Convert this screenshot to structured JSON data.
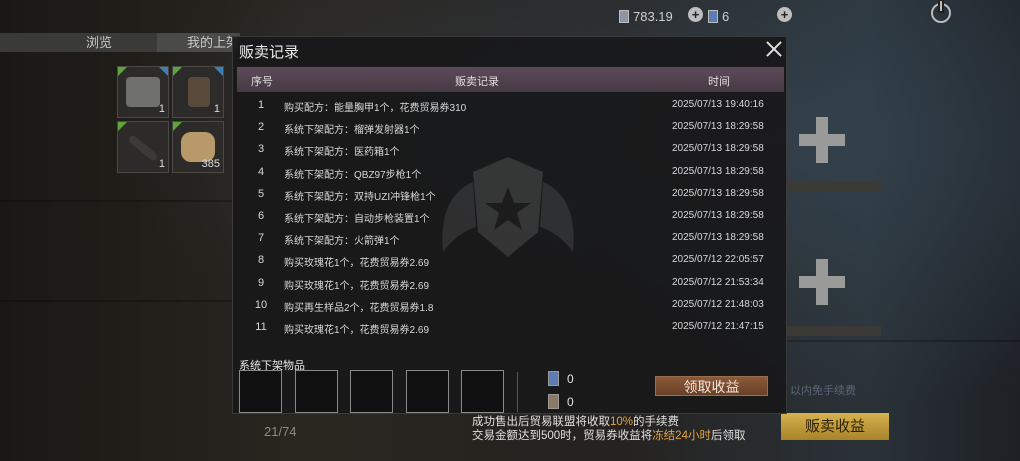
{
  "topbar": {
    "currency_value": "783.19",
    "ticket_count": "6"
  },
  "tabs": [
    {
      "label": "浏览"
    },
    {
      "label": "我的上架"
    }
  ],
  "inventory": [
    {
      "qty": "1"
    },
    {
      "qty": "1"
    },
    {
      "qty": "1"
    },
    {
      "qty": "385"
    }
  ],
  "inventory_count": "21/74",
  "modal": {
    "title": "贩卖记录",
    "columns": [
      "序号",
      "贩卖记录",
      "时间"
    ],
    "rows": [
      {
        "no": "1",
        "record": "购买配方：能量胸甲1个，花费贸易券310",
        "time": "2025/07/13 19:40:16"
      },
      {
        "no": "2",
        "record": "系统下架配方：榴弹发射器1个",
        "time": "2025/07/13 18:29:58"
      },
      {
        "no": "3",
        "record": "系统下架配方：医药箱1个",
        "time": "2025/07/13 18:29:58"
      },
      {
        "no": "4",
        "record": "系统下架配方：QBZ97步枪1个",
        "time": "2025/07/13 18:29:58"
      },
      {
        "no": "5",
        "record": "系统下架配方：双持UZI冲锋枪1个",
        "time": "2025/07/13 18:29:58"
      },
      {
        "no": "6",
        "record": "系统下架配方：自动步枪装置1个",
        "time": "2025/07/13 18:29:58"
      },
      {
        "no": "7",
        "record": "系统下架配方：火箭弹1个",
        "time": "2025/07/13 18:29:58"
      },
      {
        "no": "8",
        "record": "购买玫瑰花1个，花费贸易券2.69",
        "time": "2025/07/12 22:05:57"
      },
      {
        "no": "9",
        "record": "购买玫瑰花1个，花费贸易券2.69",
        "time": "2025/07/12 21:53:34"
      },
      {
        "no": "10",
        "record": "购买再生样品2个，花费贸易券1.8",
        "time": "2025/07/12 21:48:03"
      },
      {
        "no": "11",
        "record": "购买玫瑰花1个，花费贸易券2.69",
        "time": "2025/07/12 21:47:15"
      }
    ],
    "delisted_label": "系统下架物品",
    "count_a": "0",
    "count_b": "0",
    "claim_label": "领取收益"
  },
  "fee_note": {
    "line1_a": "成功售出后贸易联盟将收取",
    "line1_hl": "10%",
    "line1_b": "的手续费",
    "line2_a": "交易金额达到500时，贸易券收益将",
    "line2_hl": "冻结24小时",
    "line2_b": "后领取"
  },
  "bg_text": "以内免手续费",
  "sell_earn_label": "贩卖收益",
  "colors": {
    "header_bg": "#4f404b",
    "claim_btn": "#7a4c30",
    "sell_btn": "#c49c3c",
    "highlight": "#e5a33d"
  }
}
